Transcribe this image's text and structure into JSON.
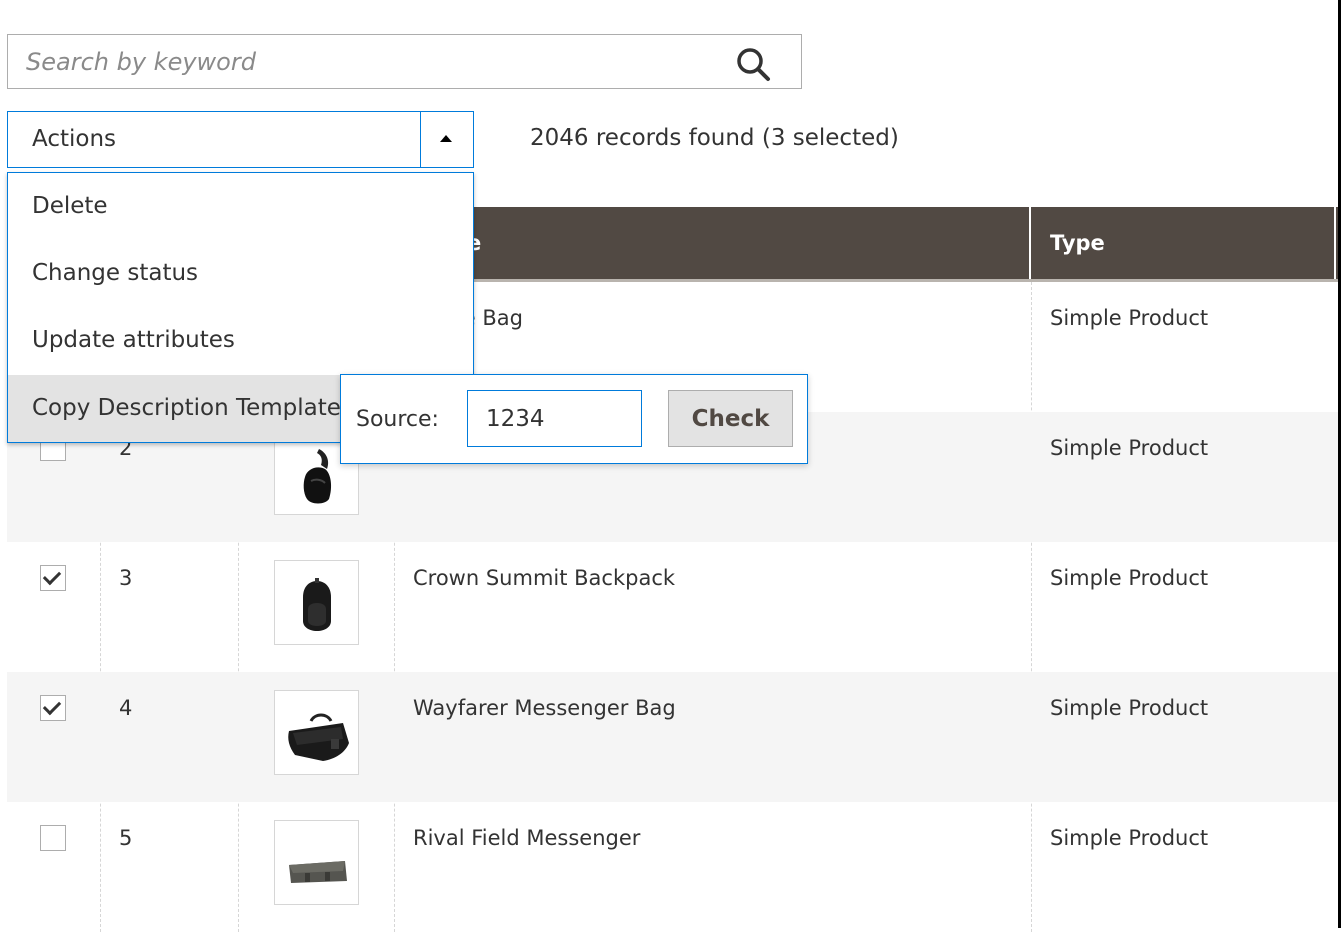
{
  "search": {
    "placeholder": "Search by keyword"
  },
  "actions": {
    "label": "Actions",
    "menu": [
      {
        "label": "Delete"
      },
      {
        "label": "Change status"
      },
      {
        "label": "Update attributes"
      },
      {
        "label": "Copy Description Template"
      }
    ],
    "active_item": "Copy Description Template"
  },
  "records_text": "2046 records found (3 selected)",
  "grid": {
    "headers": {
      "name": "e",
      "type": "Type"
    },
    "rows": [
      {
        "checked": false,
        "id": "",
        "name": "Duffle Bag",
        "type": "Simple Product"
      },
      {
        "checked": false,
        "id": "2",
        "name": "",
        "type": "Simple Product"
      },
      {
        "checked": true,
        "id": "3",
        "name": "Crown Summit Backpack",
        "type": "Simple Product"
      },
      {
        "checked": true,
        "id": "4",
        "name": "Wayfarer Messenger Bag",
        "type": "Simple Product"
      },
      {
        "checked": false,
        "id": "5",
        "name": "Rival Field Messenger",
        "type": "Simple Product"
      }
    ]
  },
  "popup": {
    "label": "Source:",
    "source_value": "1234",
    "button_label": "Check"
  },
  "colors": {
    "accent": "#007bdb",
    "header_bg": "#514943",
    "row_alt": "#f5f5f5",
    "menu_active": "#e3e3e3"
  }
}
